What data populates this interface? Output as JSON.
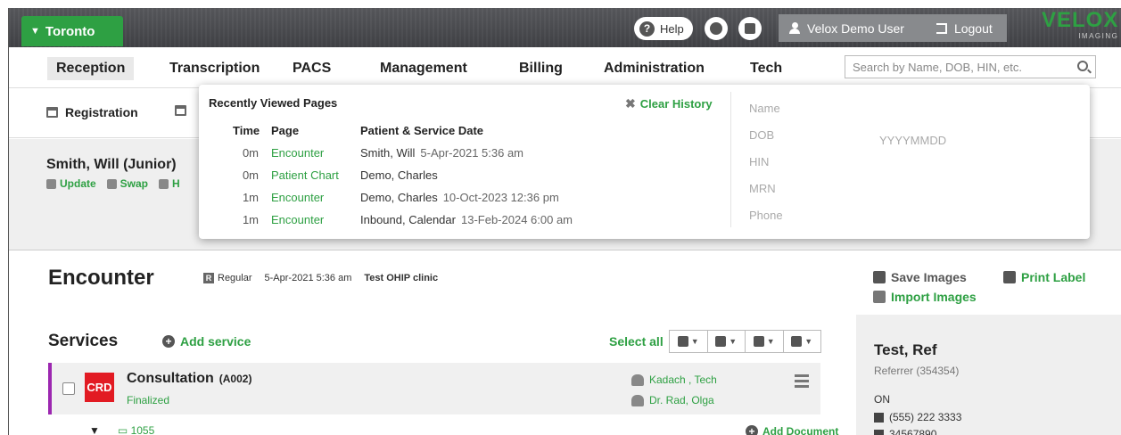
{
  "topbar": {
    "location": "Toronto",
    "help_label": "Help",
    "user_name": "Velox Demo User",
    "logout_label": "Logout",
    "logo_text": "VELOX",
    "logo_sub": "IMAGING",
    "brand_color": "#2ea043"
  },
  "nav": {
    "items": [
      "Reception",
      "Transcription",
      "PACS",
      "Management",
      "Billing",
      "Administration",
      "Tech"
    ],
    "active": "Reception"
  },
  "search": {
    "placeholder": "Search by Name, DOB, HIN, etc."
  },
  "subnav": {
    "registration": "Registration"
  },
  "patient": {
    "name": "Smith, Will (Junior)",
    "actions": [
      "Update",
      "Swap",
      "H"
    ]
  },
  "encounter": {
    "title": "Encounter",
    "type": "Regular",
    "datetime": "5-Apr-2021 5:36 am",
    "clinic": "Test OHIP clinic",
    "save_images": "Save Images",
    "import_images": "Import Images",
    "print_label": "Print Label"
  },
  "services": {
    "title": "Services",
    "add_label": "Add service",
    "select_all": "Select all",
    "row": {
      "badge": "CRD",
      "name": "Consultation",
      "code": "(A002)",
      "status": "Finalized",
      "tech": "Kadach , Tech",
      "doctor": "Dr. Rad, Olga"
    },
    "sub_folder": "1055",
    "add_document": "Add Document"
  },
  "referrer": {
    "name": "Test, Ref",
    "subtitle": "Referrer (354354)",
    "province": "ON",
    "phone": "(555) 222 3333",
    "fax": "34567890"
  },
  "recent": {
    "title": "Recently Viewed Pages",
    "clear_label": "Clear History",
    "headers": {
      "time": "Time",
      "page": "Page",
      "patient": "Patient & Service Date"
    },
    "rows": [
      {
        "time": "0m",
        "page": "Encounter",
        "patient": "Smith, Will",
        "date": "5-Apr-2021 5:36 am"
      },
      {
        "time": "0m",
        "page": "Patient Chart",
        "patient": "Demo, Charles",
        "date": ""
      },
      {
        "time": "1m",
        "page": "Encounter",
        "patient": "Demo, Charles",
        "date": "10-Oct-2023 12:36 pm"
      },
      {
        "time": "1m",
        "page": "Encounter",
        "patient": "Inbound, Calendar",
        "date": "13-Feb-2024 6:00 am"
      }
    ],
    "fields": [
      "Name",
      "DOB",
      "HIN",
      "MRN",
      "Phone"
    ],
    "dob_hint": "YYYYMMDD"
  }
}
